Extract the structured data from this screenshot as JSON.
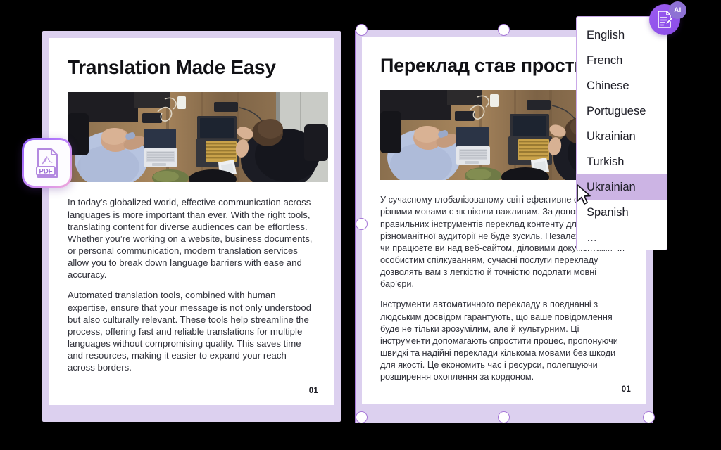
{
  "app": {
    "background_color": "#000000",
    "accent_color": "#a778d8",
    "card_frame_color": "#dcd0ef",
    "highlight_color": "#ccb4e4"
  },
  "left_document": {
    "name": "source-document",
    "title": "Translation Made Easy",
    "page_number": "01",
    "photo_alt": "two-people-working-on-laptops-overhead-view",
    "paragraphs": [
      "In today's globalized world, effective communication across languages is more important than ever. With the right tools, translating content for diverse audiences can be effortless. Whether you’re working on a website, business documents, or personal communication, modern translation services allow you to break down language barriers with ease and accuracy.",
      "Automated translation tools, combined with human expertise, ensure that your message is not only understood but also culturally relevant. These tools help streamline the process, offering fast and reliable translations for multiple languages without compromising quality. This saves time and resources, making it easier to expand your reach across borders."
    ]
  },
  "right_document": {
    "name": "translated-document",
    "title": "Переклад став простим",
    "page_number": "01",
    "photo_alt": "two-people-working-on-laptops-overhead-view",
    "paragraphs": [
      "У сучасному глобалізованому світі ефективне спілкування різними мовами є як ніколи важливим. За допомогою правильних інструментів переклад контенту для різноманітної аудиторії не буде зусиль. Незалежно від того, чи працюєте ви над веб-сайтом, діловими документами чи особистим спілкуванням, сучасні послуги перекладу дозволять вам з легкістю й точністю подолати мовні бар’єри.",
      "Інструменти автоматичного перекладу в поєднанні з людським досвідом гарантують, що ваше повідомлення буде не тільки зрозумілим, але й культурним. Ці інструменти допомагають спростити процес, пропонуючи швидкі та надійні переклади кількома мовами без шкоди для якості. Це економить час і ресурси, полегшуючи розширення охоплення за кордоном."
    ]
  },
  "language_dropdown": {
    "name": "language-select-menu",
    "selected_index": 6,
    "items": [
      {
        "label": "English",
        "selected": false
      },
      {
        "label": "French",
        "selected": false
      },
      {
        "label": "Chinese",
        "selected": false
      },
      {
        "label": "Portuguese",
        "selected": false
      },
      {
        "label": "Ukrainian",
        "selected": false
      },
      {
        "label": "Turkish",
        "selected": false
      },
      {
        "label": "Ukrainian",
        "selected": true
      },
      {
        "label": "Spanish",
        "selected": false
      },
      {
        "label": "…",
        "selected": false
      }
    ]
  },
  "badges": {
    "ai_label": "AI",
    "pdf_label": "PDF",
    "doc_icon": "document-with-pencil-icon",
    "pdf_icon": "pdf-file-icon"
  }
}
